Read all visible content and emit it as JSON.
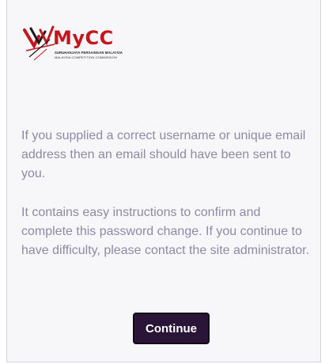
{
  "logo": {
    "brand": "MyCC",
    "line1": "SURUHANJAYA PERSAINGAN MALAYSIA",
    "line2": "MALAYSIA COMPETITION COMMISSION",
    "colors": {
      "red": "#c4161c",
      "dark": "#1b1b1b"
    }
  },
  "message": {
    "paragraph1": "If you supplied a correct username or unique email address then an email should have been sent to you.",
    "paragraph2": "It contains easy instructions to confirm and complete this password change. If you continue to have difficulty, please contact the site administrator."
  },
  "actions": {
    "continue_label": "Continue"
  },
  "colors": {
    "text": "#8d8aa3",
    "button_bg": "#2a1538",
    "card_bg": "#f7f7fa"
  }
}
